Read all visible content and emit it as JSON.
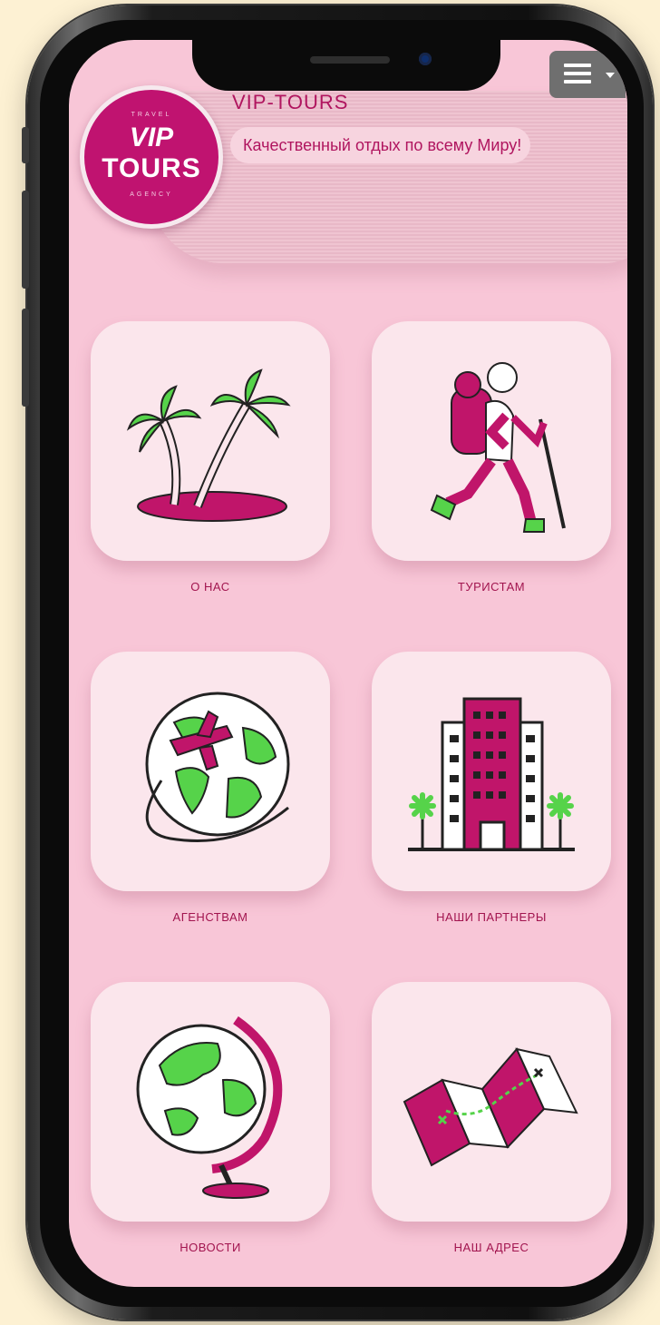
{
  "header": {
    "logo_top_text": "TRAVEL",
    "logo_vip": "VIP",
    "logo_tours": "TOURS",
    "logo_bottom_text": "AGENCY",
    "site_name": "VIP-TOURS",
    "tagline": "Качественный отдых по всему Миру!"
  },
  "menu": {
    "icon": "hamburger-menu-icon"
  },
  "tiles": [
    {
      "label": "О НАС",
      "icon": "palm-island-icon"
    },
    {
      "label": "ТУРИСТАМ",
      "icon": "hiker-icon"
    },
    {
      "label": "АГЕНСТВАМ",
      "icon": "globe-airplane-icon"
    },
    {
      "label": "НАШИ ПАРТНЕРЫ",
      "icon": "hotel-building-icon"
    },
    {
      "label": "НОВОСТИ",
      "icon": "desk-globe-icon"
    },
    {
      "label": "НАШ АДРЕС",
      "icon": "folded-map-icon"
    }
  ],
  "colors": {
    "accent": "#b0155f",
    "screen_bg": "#f8c6d7",
    "tile_bg": "#fbe6ec",
    "icon_green": "#56d34a",
    "page_bg": "#fdf1d3"
  }
}
